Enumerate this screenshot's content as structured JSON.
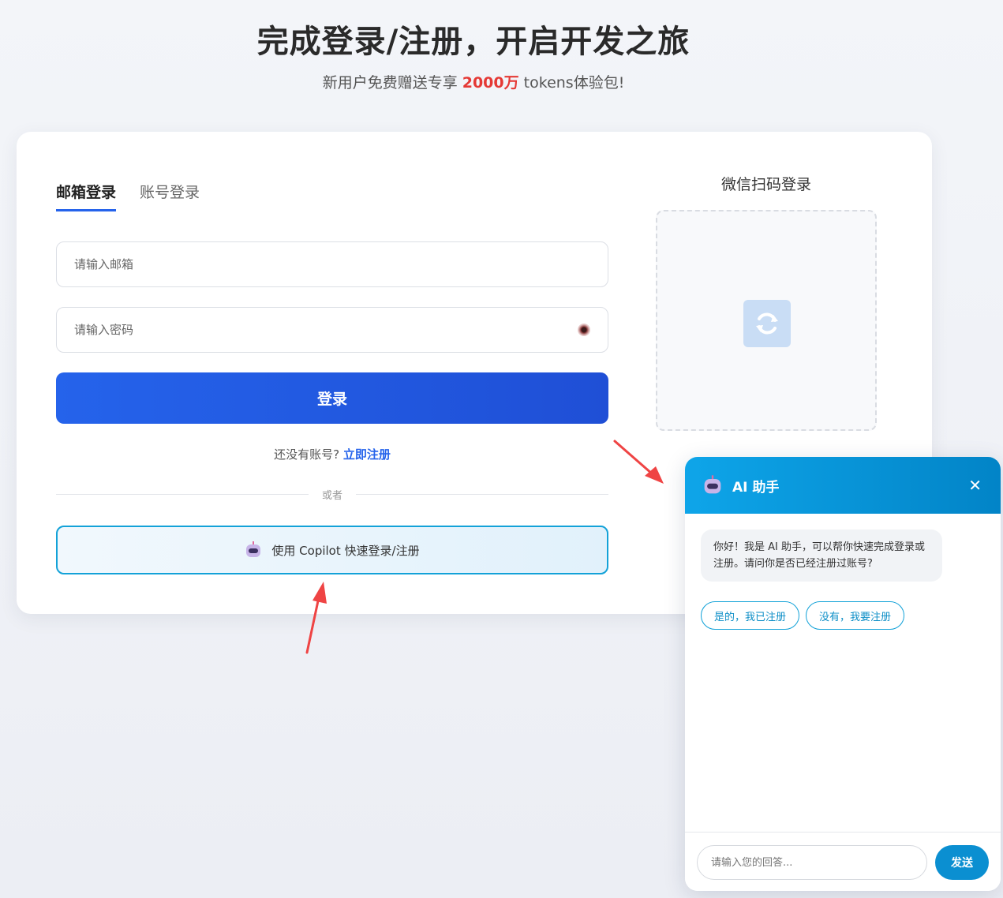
{
  "hero": {
    "title": "完成登录/注册，开启开发之旅",
    "subtitle_prefix": "新用户免费赠送专享 ",
    "subtitle_highlight": "2000万",
    "subtitle_suffix": " tokens体验包!"
  },
  "login": {
    "tabs": [
      {
        "label": "邮箱登录",
        "active": true
      },
      {
        "label": "账号登录",
        "active": false
      }
    ],
    "email_placeholder": "请输入邮箱",
    "password_placeholder": "请输入密码",
    "submit_label": "登录",
    "no_account_text": "还没有账号?",
    "register_link": "立即注册",
    "divider_text": "或者",
    "copilot_label": "使用 Copilot 快速登录/注册"
  },
  "wechat": {
    "title": "微信扫码登录",
    "icon": "refresh-icon"
  },
  "chat": {
    "title": "AI 助手",
    "close_icon": "close-icon",
    "message": "你好！我是 AI 助手，可以帮你快速完成登录或注册。请问你是否已经注册过账号?",
    "choices": [
      "是的，我已注册",
      "没有，我要注册"
    ],
    "input_placeholder": "请输入您的回答...",
    "send_label": "发送"
  },
  "colors": {
    "primary": "#2563eb",
    "accent": "#0ea5e9",
    "highlight": "#e53935",
    "annotation_arrow": "#ef4444"
  }
}
